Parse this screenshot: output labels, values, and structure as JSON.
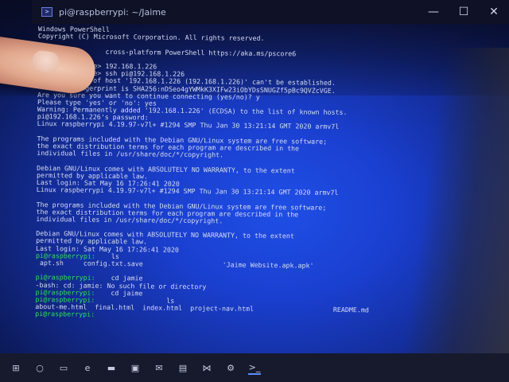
{
  "window": {
    "title": "pi@raspberrypi: ~/Jaime",
    "controls": {
      "minimize": "—",
      "maximize": "☐",
      "close": "✕"
    }
  },
  "terminal": {
    "lines": [
      {
        "text": "Windows PowerShell",
        "prompt": ""
      },
      {
        "text": "Copyright (C) Microsoft Corporation. All rights reserved.",
        "prompt": ""
      },
      {
        "text": "",
        "prompt": ""
      },
      {
        "text": "                 cross-platform PowerShell https://aka.ms/pscore6",
        "prompt": ""
      },
      {
        "text": "",
        "prompt": ""
      },
      {
        "text": "            ice> 192.168.1.226",
        "prompt": ""
      },
      {
        "text": "            ice> ssh pi@192.168.1.226",
        "prompt": ""
      },
      {
        "text": "            y of host '192.168.1.226 (192.168.1.226)' can't be established.",
        "prompt": ""
      },
      {
        "text": "          ingerprint is SHA256:nDSeo4gYWMkK3XIFw23iObYDsSNUGZf5pBc9QVZcVGE.",
        "prompt": ""
      },
      {
        "text": "Are you sure you want to continue connecting (yes/no)? y",
        "prompt": ""
      },
      {
        "text": "Please type 'yes' or 'no': yes",
        "prompt": ""
      },
      {
        "text": "Warning: Permanently added '192.168.1.226' (ECDSA) to the list of known hosts.",
        "prompt": ""
      },
      {
        "text": "pi@192.168.1.226's password:",
        "prompt": ""
      },
      {
        "text": "Linux raspberrypi 4.19.97-v7l+ #1294 SMP Thu Jan 30 13:21:14 GMT 2020 armv7l",
        "prompt": ""
      },
      {
        "text": "",
        "prompt": ""
      },
      {
        "text": "The programs included with the Debian GNU/Linux system are free software;",
        "prompt": ""
      },
      {
        "text": "the exact distribution terms for each program are described in the",
        "prompt": ""
      },
      {
        "text": "individual files in /usr/share/doc/*/copyright.",
        "prompt": ""
      },
      {
        "text": "",
        "prompt": ""
      },
      {
        "text": "Debian GNU/Linux comes with ABSOLUTELY NO WARRANTY, to the extent",
        "prompt": ""
      },
      {
        "text": "permitted by applicable law.",
        "prompt": ""
      },
      {
        "text": "Last login: Sat May 16 17:26:41 2020",
        "prompt": ""
      },
      {
        "text": "Linux raspberrypi 4.19.97-v7l+ #1294 SMP Thu Jan 30 13:21:14 GMT 2020 armv7l",
        "prompt": ""
      },
      {
        "text": "",
        "prompt": ""
      },
      {
        "text": "The programs included with the Debian GNU/Linux system are free software;",
        "prompt": ""
      },
      {
        "text": "the exact distribution terms for each program are described in the",
        "prompt": ""
      },
      {
        "text": "individual files in /usr/share/doc/*/copyright.",
        "prompt": ""
      },
      {
        "text": "",
        "prompt": ""
      },
      {
        "text": "Debian GNU/Linux comes with ABSOLUTELY NO WARRANTY, to the extent",
        "prompt": ""
      },
      {
        "text": "permitted by applicable law.",
        "prompt": ""
      },
      {
        "text": "Last login: Sat May 16 17:26:41 2020",
        "prompt": ""
      },
      {
        "text": "    ls",
        "prompt": "pi@raspberrypi:"
      },
      {
        "text": " apt.sh     config.txt.save                    'Jaime Website.apk.apk'",
        "prompt": ""
      },
      {
        "text": "",
        "prompt": ""
      },
      {
        "text": "    cd jamie",
        "prompt": "pi@raspberrypi:"
      },
      {
        "text": "-bash: cd: jamie: No such file or directory",
        "prompt": ""
      },
      {
        "text": "    cd jaime",
        "prompt": "pi@raspberrypi:"
      },
      {
        "text": "                  ls",
        "prompt": "pi@raspberrypi:"
      },
      {
        "text": "about-me.html  final.html  index.html  project-nav.html                    README.md",
        "prompt": ""
      },
      {
        "text": "",
        "prompt": "pi@raspberrypi:"
      }
    ]
  },
  "taskbar": {
    "items": [
      {
        "name": "windows-start-icon",
        "glyph": "⊞",
        "active": false
      },
      {
        "name": "search-icon",
        "glyph": "○",
        "active": false
      },
      {
        "name": "task-view-icon",
        "glyph": "▭",
        "active": false
      },
      {
        "name": "edge-browser-icon",
        "glyph": "e",
        "active": false
      },
      {
        "name": "file-explorer-icon",
        "glyph": "▬",
        "active": false
      },
      {
        "name": "store-icon",
        "glyph": "▣",
        "active": false
      },
      {
        "name": "mail-icon",
        "glyph": "✉",
        "active": false
      },
      {
        "name": "app-icon",
        "glyph": "▤",
        "active": false
      },
      {
        "name": "vscode-icon",
        "glyph": "⋈",
        "active": false
      },
      {
        "name": "settings-icon",
        "glyph": "⚙",
        "active": false
      },
      {
        "name": "terminal-icon",
        "glyph": ">_",
        "active": true
      }
    ]
  }
}
